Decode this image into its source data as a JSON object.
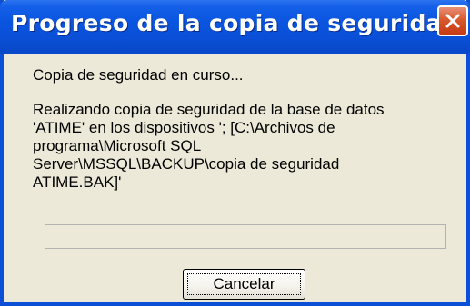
{
  "window": {
    "title": "Progreso de la copia de seguridad",
    "close_icon": "close-icon"
  },
  "content": {
    "status": "Copia de seguridad en curso...",
    "detail_lines": [
      "Realizando copia de seguridad de la base de datos",
      "'ATIME' en los dispositivos '; [C:\\Archivos de",
      "programa\\Microsoft SQL",
      "Server\\MSSQL\\BACKUP\\copia de seguridad",
      "ATIME.BAK]'"
    ]
  },
  "progress": {
    "value": 0
  },
  "buttons": {
    "cancel_label": "Cancelar"
  },
  "colors": {
    "titlebar": "#0a4fd6",
    "dialog_bg": "#ece9d8",
    "close_button": "#d8582c",
    "progress_fill": "#2fb82f"
  }
}
